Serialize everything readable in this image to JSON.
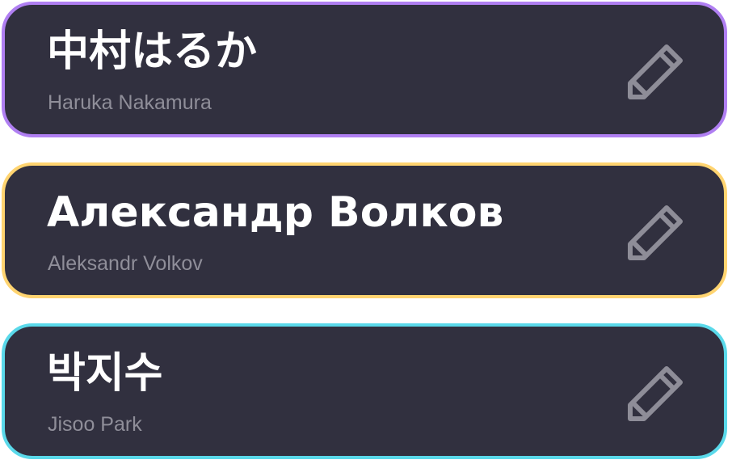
{
  "contacts": [
    {
      "native_name": "中村はるか",
      "romanized_name": "Haruka Nakamura",
      "accent_color": "#b07ff2"
    },
    {
      "native_name": "Александр Волков",
      "romanized_name": "Aleksandr Volkov",
      "accent_color": "#ffd470"
    },
    {
      "native_name": "박지수",
      "romanized_name": "Jisoo Park",
      "accent_color": "#5ad9ea"
    }
  ],
  "card_background": "#31303f",
  "icon_color": "#8e8d98",
  "edit_icon": "pencil-icon"
}
